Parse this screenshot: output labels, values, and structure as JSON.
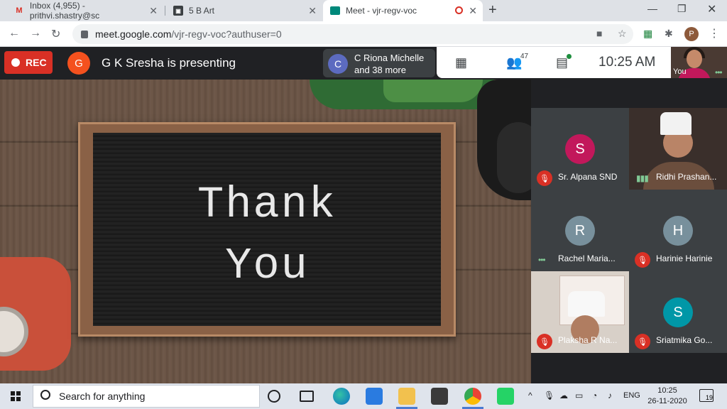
{
  "tabs": [
    {
      "label": "Inbox (4,955) - prithvi.shastry@sc",
      "icon": "gmail-icon"
    },
    {
      "label": "5 B Art",
      "icon": "classroom-icon"
    },
    {
      "label": "Meet - vjr-regv-voc",
      "icon": "meet-icon",
      "active": true
    }
  ],
  "toolbar": {
    "url_host": "meet.google.com",
    "url_path": "/vjr-regv-voc?authuser=0",
    "profile_initial": "P"
  },
  "meet": {
    "rec_label": "REC",
    "presenter_initial": "G",
    "presenter_text": "G K Sresha is presenting",
    "pill_initial": "C",
    "pill_line1": "C Riona Michelle",
    "pill_line2": "and 38 more",
    "participant_count": "47",
    "time": "10:25 AM",
    "self_label": "You"
  },
  "slide": {
    "line1": "Thank",
    "line2": "You"
  },
  "tiles": [
    {
      "name": "Sr. Alpana SND",
      "initial": "S",
      "color": "#c2185b",
      "muted": true,
      "video": false
    },
    {
      "name": "Ridhi Prashan...",
      "initial": "",
      "color": "",
      "muted": false,
      "video": true
    },
    {
      "name": "Rachel Maria...",
      "initial": "R",
      "color": "#78909c",
      "muted": false,
      "video": false
    },
    {
      "name": "Harinie Harinie",
      "initial": "H",
      "color": "#78909c",
      "muted": true,
      "video": false
    },
    {
      "name": "Plaksha R Na...",
      "initial": "",
      "color": "",
      "muted": true,
      "video": true
    },
    {
      "name": "Sriatmika Go...",
      "initial": "S",
      "color": "#0097a7",
      "muted": true,
      "video": false
    }
  ],
  "taskbar": {
    "search_placeholder": "Search for anything",
    "lang": "ENG",
    "time": "10:25",
    "date": "26-11-2020",
    "notif_count": "19"
  }
}
